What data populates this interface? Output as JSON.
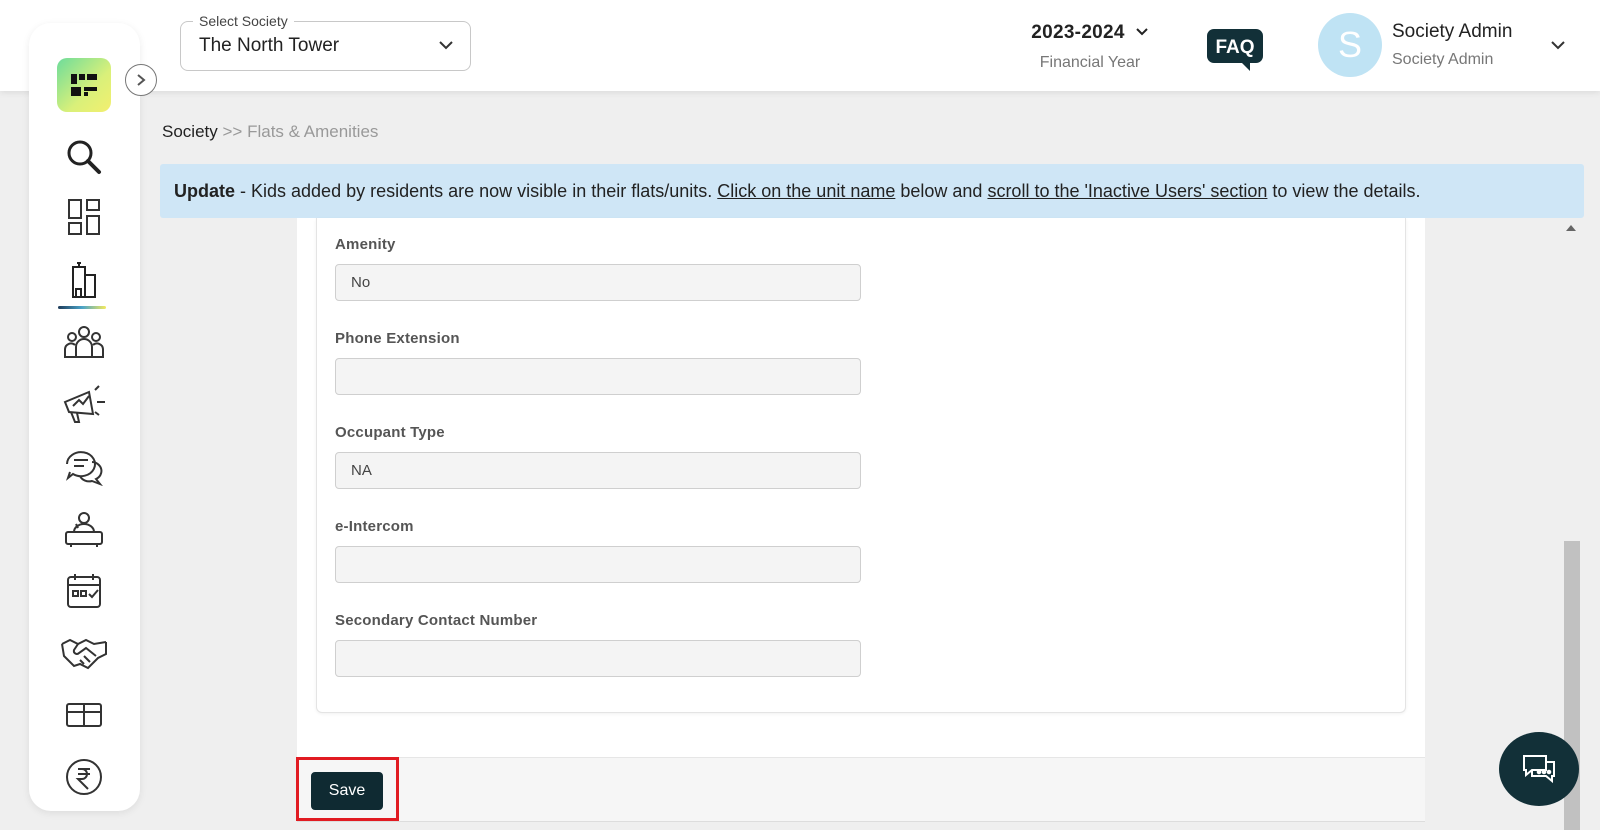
{
  "header": {
    "society_select": {
      "label": "Select Society",
      "value": "The North Tower"
    },
    "financial_year": {
      "value": "2023-2024",
      "label": "Financial Year"
    },
    "faq_label": "FAQ",
    "profile": {
      "initial": "S",
      "name": "Society Admin",
      "role": "Society Admin"
    }
  },
  "breadcrumb": {
    "root": "Society",
    "separator": ">>",
    "current": "Flats & Amenities"
  },
  "banner": {
    "bold": "Update",
    "text1": " - Kids added by residents are now visible in their flats/units. ",
    "link1": "Click on the unit name",
    "text2": " below and ",
    "link2": "scroll to the 'Inactive Users' section",
    "text3": " to view the details."
  },
  "form": {
    "fields": [
      {
        "label": "Amenity",
        "value": "No"
      },
      {
        "label": "Phone Extension",
        "value": ""
      },
      {
        "label": "Occupant Type",
        "value": "NA"
      },
      {
        "label": "e-Intercom",
        "value": ""
      },
      {
        "label": "Secondary Contact Number",
        "value": ""
      }
    ],
    "save_label": "Save"
  },
  "sidebar": {
    "icons": [
      "search-icon",
      "dashboard-icon",
      "building-icon",
      "community-icon",
      "announcement-icon",
      "chat-bubbles-icon",
      "helpdesk-icon",
      "calendar-icon",
      "handshake-icon",
      "box-icon",
      "rupee-icon"
    ],
    "active": "building-icon"
  },
  "colors": {
    "accent": "#0f2a32",
    "banner": "#cfe6f6",
    "highlight": "#e11b22",
    "avatar": "#bfe3f4"
  }
}
